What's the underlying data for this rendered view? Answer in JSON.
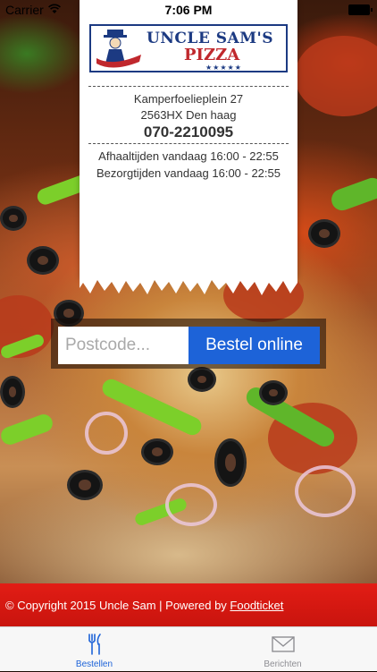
{
  "status_bar": {
    "carrier": "Carrier",
    "time": "7:06 PM"
  },
  "logo": {
    "title": "UNCLE SAM'S",
    "subtitle": "PIZZA",
    "stars": "★★★★★"
  },
  "restaurant": {
    "street": "Kamperfoelieplein 27",
    "postal_city": "2563HX Den haag",
    "phone": "070-2210095",
    "pickup_hours": "Afhaaltijden vandaag 16:00 - 22:55",
    "delivery_hours": "Bezorgtijden vandaag 16:00 - 22:55"
  },
  "order": {
    "postcode_placeholder": "Postcode...",
    "order_button": "Bestel online"
  },
  "footer": {
    "copyright": "© Copyright 2015 Uncle Sam | Powered by ",
    "link": "Foodticket"
  },
  "tabs": [
    {
      "label": "Bestellen",
      "icon": "fork-knife-icon",
      "active": true
    },
    {
      "label": "Berichten",
      "icon": "envelope-icon",
      "active": false
    }
  ],
  "colors": {
    "accent": "#1d63d8",
    "footer": "#e21d15",
    "logo_blue": "#1c3a82",
    "logo_red": "#c0282d"
  }
}
